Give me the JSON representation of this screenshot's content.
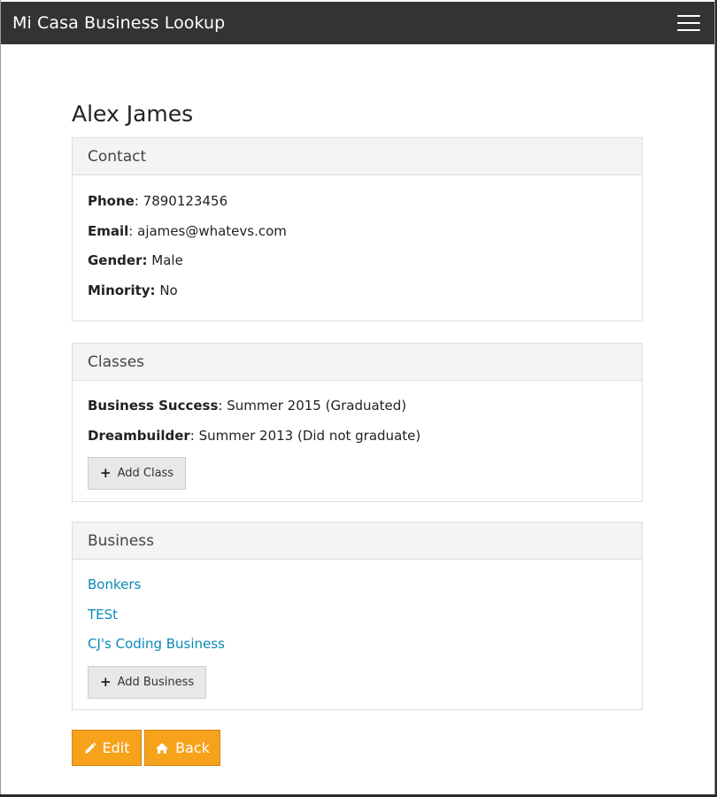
{
  "navbar": {
    "brand": "Mi Casa Business Lookup",
    "menu_icon": "hamburger-menu-icon"
  },
  "person": {
    "name": "Alex James"
  },
  "contact": {
    "heading": "Contact",
    "fields": [
      {
        "label": "Phone",
        "sep": ": ",
        "value": "7890123456"
      },
      {
        "label": "Email",
        "sep": ": ",
        "value": "ajames@whatevs.com"
      },
      {
        "label": "Gender:",
        "sep": " ",
        "value": "Male"
      },
      {
        "label": "Minority:",
        "sep": " ",
        "value": "No"
      }
    ]
  },
  "classes": {
    "heading": "Classes",
    "items": [
      {
        "name": "Business Success",
        "sep": ": ",
        "detail": "Summer 2015 (Graduated)"
      },
      {
        "name": "Dreambuilder",
        "sep": ": ",
        "detail": "Summer 2013 (Did not graduate)"
      }
    ],
    "add_label": "Add Class"
  },
  "business": {
    "heading": "Business",
    "items": [
      "Bonkers",
      "TESt",
      "CJ's Coding Business"
    ],
    "add_label": "Add Business"
  },
  "actions": {
    "edit_label": "Edit",
    "back_label": "Back"
  },
  "colors": {
    "navbar": "#333333",
    "link": "#0a8ab8",
    "action_button": "#f6a21b"
  }
}
